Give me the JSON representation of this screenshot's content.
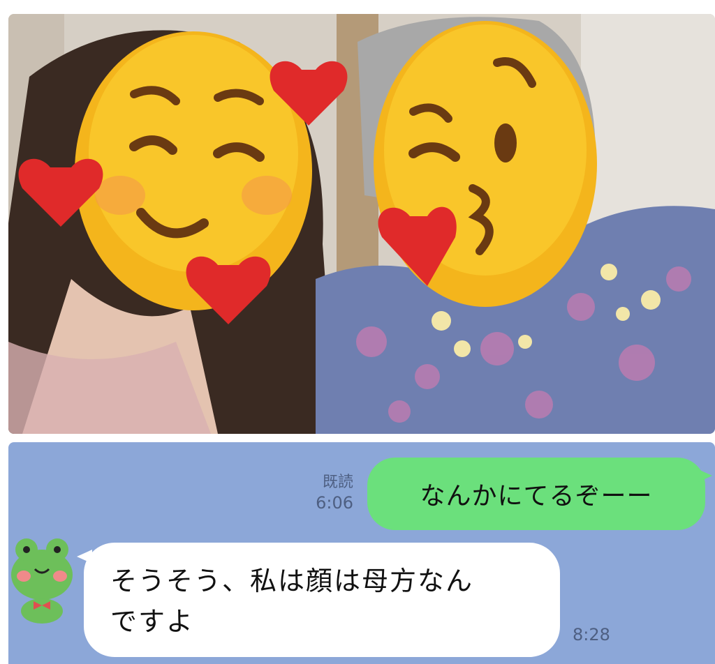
{
  "photo": {
    "description_icon_left": "smiling-face-with-hearts-emoji",
    "description_icon_right": "kissing-face-emoji"
  },
  "chat": {
    "background": "#8ca7d8",
    "outgoing": {
      "read_label": "既読",
      "time": "6:06",
      "text": "なんかにてるぞーー",
      "bubble_color": "#6be07c"
    },
    "incoming": {
      "avatar_icon": "frog-avatar-icon",
      "line1": "そうそう、私は顔は母方なん",
      "line2": "ですよ",
      "time": "8:28",
      "bubble_color": "#ffffff"
    }
  }
}
